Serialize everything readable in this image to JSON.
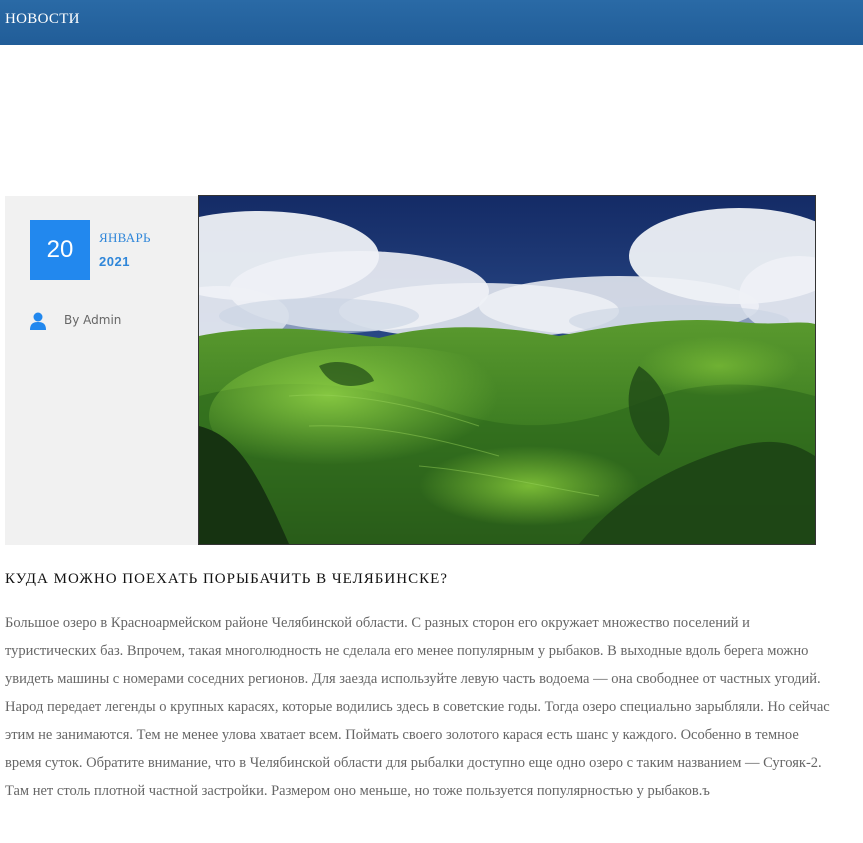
{
  "header": {
    "title": "НОВОСТИ"
  },
  "post": {
    "date": {
      "day": "20",
      "month": "ЯНВАРЬ",
      "year": "2021"
    },
    "author": "By Admin",
    "image": {
      "description_icon": "landscape-photo"
    },
    "title": "КУДА МОЖНО ПОЕХАТЬ ПОРЫБАЧИТЬ В ЧЕЛЯБИНСКЕ?",
    "body": "Большое озеро в Красноармейском районе Челябинской области. С разных сторон его окружает множество поселений и туристических баз. Впрочем, такая многолюдность не сделала его менее популярным у рыбаков. В выходные вдоль берега можно увидеть машины с номерами соседних регионов. Для заезда используйте левую часть водоема — она свободнее от частных угодий. Народ передает легенды о крупных карасях, которые водились здесь в советские годы. Тогда озеро специально зарыбляли. Но сейчас этим не занимаются. Тем не менее улова хватает всем. Поймать своего золотого карася есть шанс у каждого. Особенно в темное время суток. Обратите внимание, что в Челябинской области для рыбалки доступно еще одно озеро с таким названием — Сугояк-2. Там нет столь плотной частной застройки. Размером оно меньше, но тоже пользуется популярностью у рыбаков.ъ"
  },
  "colors": {
    "header_bg": "#215d98",
    "accent": "#2288ee",
    "panel_bg": "#f1f1f1",
    "body_text": "#666666"
  }
}
